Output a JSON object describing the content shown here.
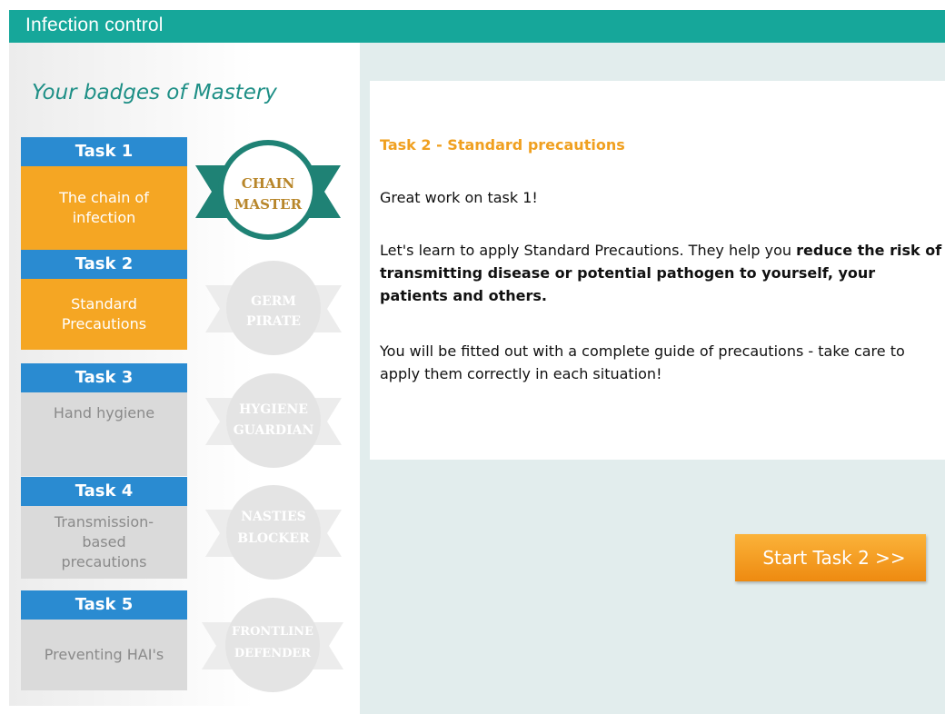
{
  "header": {
    "title": "Infection control"
  },
  "sidebar": {
    "title": "Your badges of Mastery",
    "tasks": [
      {
        "head": "Task 1",
        "body": "The chain of infection",
        "status": "done"
      },
      {
        "head": "Task 2",
        "body": "Standard Precautions",
        "status": "done"
      },
      {
        "head": "Task 3",
        "body": "Hand hygiene",
        "status": "locked"
      },
      {
        "head": "Task 4",
        "body": "Transmission-based precautions",
        "status": "locked"
      },
      {
        "head": "Task 5",
        "body": "Preventing HAI's",
        "status": "locked"
      }
    ],
    "badges": [
      {
        "line1": "CHAIN",
        "line2": "MASTER",
        "earned": true
      },
      {
        "line1": "GERM",
        "line2": "PIRATE",
        "earned": false
      },
      {
        "line1": "HYGIENE",
        "line2": "GUARDIAN",
        "earned": false
      },
      {
        "line1": "NASTIES",
        "line2": "BLOCKER",
        "earned": false
      },
      {
        "line1": "FRONTLINE",
        "line2": "DEFENDER",
        "earned": false
      }
    ]
  },
  "main": {
    "task_title": "Task 2 - Standard precautions",
    "greeting": "Great work on task 1!",
    "intro_plain": "Let's learn to apply Standard Precautions. They help you ",
    "intro_bold": "reduce the risk of transmitting disease or potential pathogen to yourself, your patients and others.",
    "note": "You will be fitted out with a complete guide of precautions - take care to apply them correctly in each situation!",
    "start_button": "Start Task 2 >>"
  },
  "colors": {
    "header": "#16a79a",
    "task_head": "#2a8bd1",
    "task_done": "#f5a623",
    "task_locked": "#dadada",
    "badge_earned": "#1f8275",
    "accent_orange": "#f0a020"
  }
}
